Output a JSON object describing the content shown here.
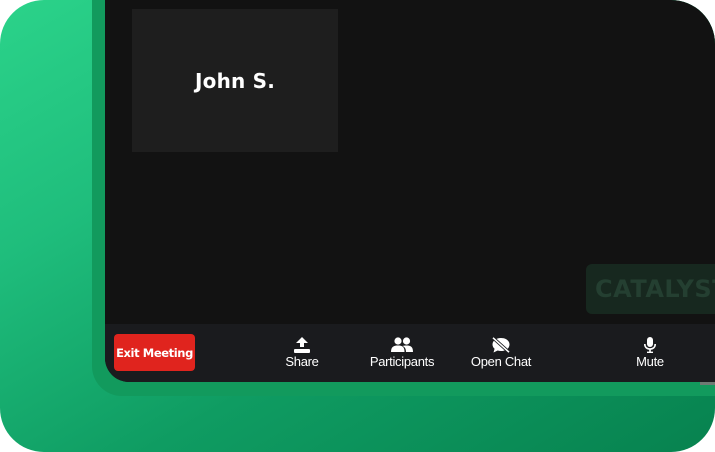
{
  "participant_tile": {
    "name": "John S."
  },
  "watermark": {
    "text": "CATALYST"
  },
  "toolbar": {
    "exit_label": "Exit Meeting",
    "share": {
      "label": "Share",
      "icon": "upload-icon"
    },
    "participants": {
      "label": "Participants",
      "icon": "people-icon"
    },
    "chat": {
      "label": "Open Chat",
      "icon": "chat-off-icon"
    },
    "mute": {
      "label": "Mute",
      "icon": "microphone-icon"
    }
  },
  "colors": {
    "accent_green": "#1fbd7c",
    "screen_bg": "#121212",
    "toolbar_bg": "#1a1b1e",
    "exit_red": "#e0241e"
  }
}
